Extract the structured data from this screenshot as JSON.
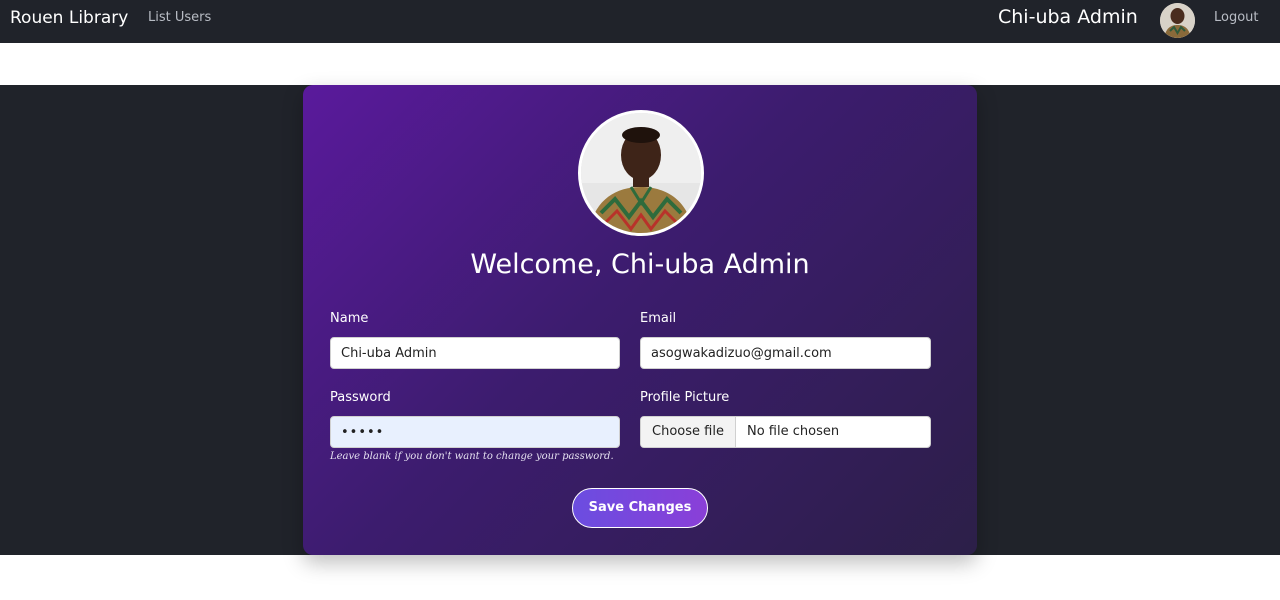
{
  "navbar": {
    "brand": "Rouen Library",
    "links": [
      "List Users"
    ],
    "user_name": "Chi-uba Admin",
    "logout": "Logout"
  },
  "profile": {
    "welcome": "Welcome, Chi-uba Admin"
  },
  "form": {
    "name_label": "Name",
    "name_value": "Chi-uba Admin",
    "email_label": "Email",
    "email_value": "asogwakadizuo@gmail.com",
    "password_label": "Password",
    "password_value": "•••••",
    "password_hint": "Leave blank if you don't want to change your password.",
    "picture_label": "Profile Picture",
    "file_button": "Choose file",
    "file_status": "No file chosen",
    "save_label": "Save Changes"
  },
  "colors": {
    "navbar": "#20232a",
    "card_start": "#5a1a9c",
    "card_end": "#2c1f48",
    "button_start": "#6b4de0",
    "button_end": "#8a3fd8"
  },
  "icons": {
    "avatar": "user-avatar-photo"
  }
}
